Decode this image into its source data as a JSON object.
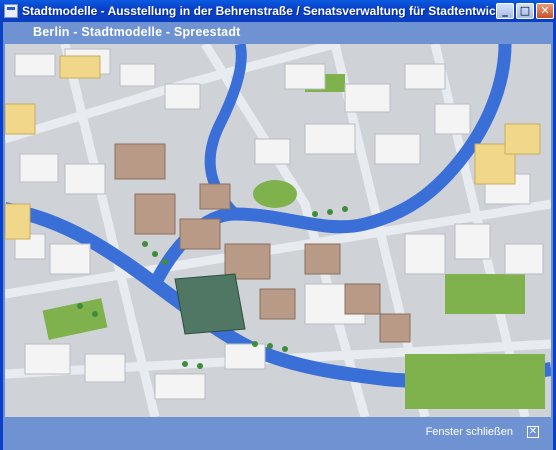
{
  "window": {
    "title": "Stadtmodelle - Ausstellung in der Behrenstraße / Senatsverwaltung für Stadtentwicklung",
    "minimize_glyph": "_",
    "maximize_glyph": "□",
    "close_glyph": "✕"
  },
  "header": {
    "title": "Berlin - Stadtmodelle - Spreestadt"
  },
  "map": {
    "icon": "3d-city-model-image",
    "colors": {
      "ground": "#cfd3d8",
      "river": "#3a6fd8",
      "buildings": "#f4f4f4",
      "highlight_buildings": "#b99a86",
      "parks": "#7fb24c",
      "yellow_buildings": "#f0d78a"
    }
  },
  "footer": {
    "close_label": "Fenster schließen",
    "close_icon_glyph": "✕"
  }
}
